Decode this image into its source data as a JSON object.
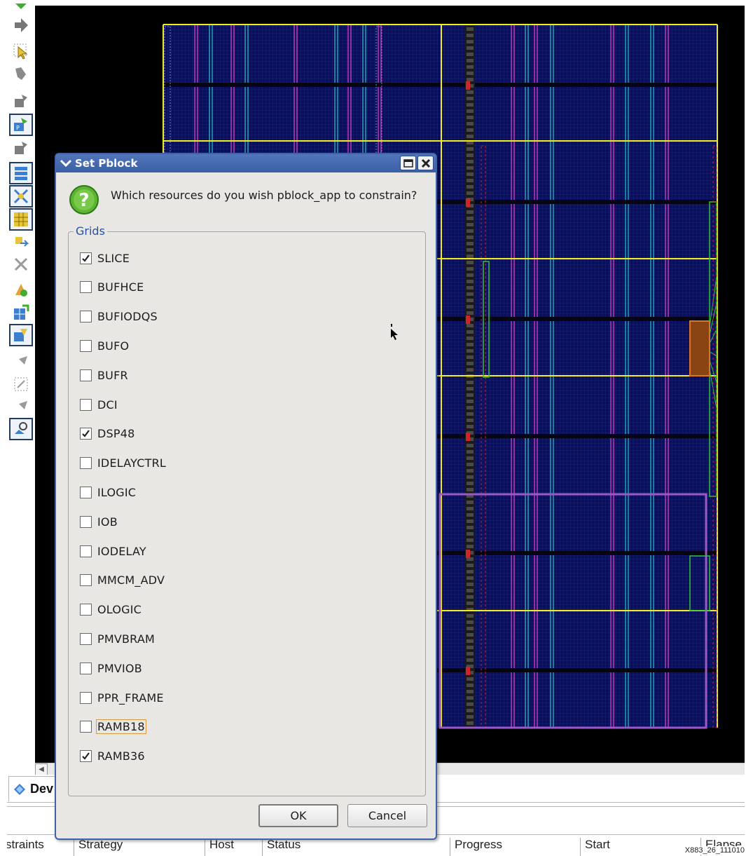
{
  "dialog": {
    "title": "Set Pblock",
    "question": "Which resources do you wish pblock_app to constrain?",
    "group_label": "Grids",
    "items": [
      {
        "label": "SLICE",
        "checked": true
      },
      {
        "label": "BUFHCE",
        "checked": false
      },
      {
        "label": "BUFIODQS",
        "checked": false
      },
      {
        "label": "BUFO",
        "checked": false
      },
      {
        "label": "BUFR",
        "checked": false
      },
      {
        "label": "DCI",
        "checked": false
      },
      {
        "label": "DSP48",
        "checked": true
      },
      {
        "label": "IDELAYCTRL",
        "checked": false
      },
      {
        "label": "ILOGIC",
        "checked": false
      },
      {
        "label": "IOB",
        "checked": false
      },
      {
        "label": "IODELAY",
        "checked": false
      },
      {
        "label": "MMCM_ADV",
        "checked": false
      },
      {
        "label": "OLOGIC",
        "checked": false
      },
      {
        "label": "PMVBRAM",
        "checked": false
      },
      {
        "label": "PMVIOB",
        "checked": false
      },
      {
        "label": "PPR_FRAME",
        "checked": false
      },
      {
        "label": "RAMB18",
        "checked": false
      },
      {
        "label": "RAMB36",
        "checked": true
      }
    ],
    "ok_label": "OK",
    "cancel_label": "Cancel"
  },
  "bottom": {
    "device_tab": "Dev",
    "columns": [
      "straints",
      "Strategy",
      "Host",
      "Status",
      "Progress",
      "Start",
      "Elapse"
    ]
  },
  "figure_id": "X883_26_111010",
  "colors": {
    "title_bar": "#3f63a6",
    "device_background": "#0a0f5c",
    "clock_region_lines": "#f0ec1d",
    "pblock_outline": "#9b59c7",
    "column_magenta": "#c236b8",
    "column_cyan": "#23c4c4",
    "group_label": "#2950a5"
  },
  "icons": [
    "arrow-up-icon",
    "arrow-right-icon",
    "select-icon",
    "hand-icon",
    "place-icon",
    "pblock-icon",
    "place-icon",
    "list-icon",
    "route-icon",
    "grid-icon",
    "move-icon",
    "unroute-icon",
    "bell-icon",
    "grid-add-icon",
    "pblock-edit-icon",
    "tool-icon",
    "crop-icon",
    "tool-icon",
    "magnify-icon"
  ]
}
